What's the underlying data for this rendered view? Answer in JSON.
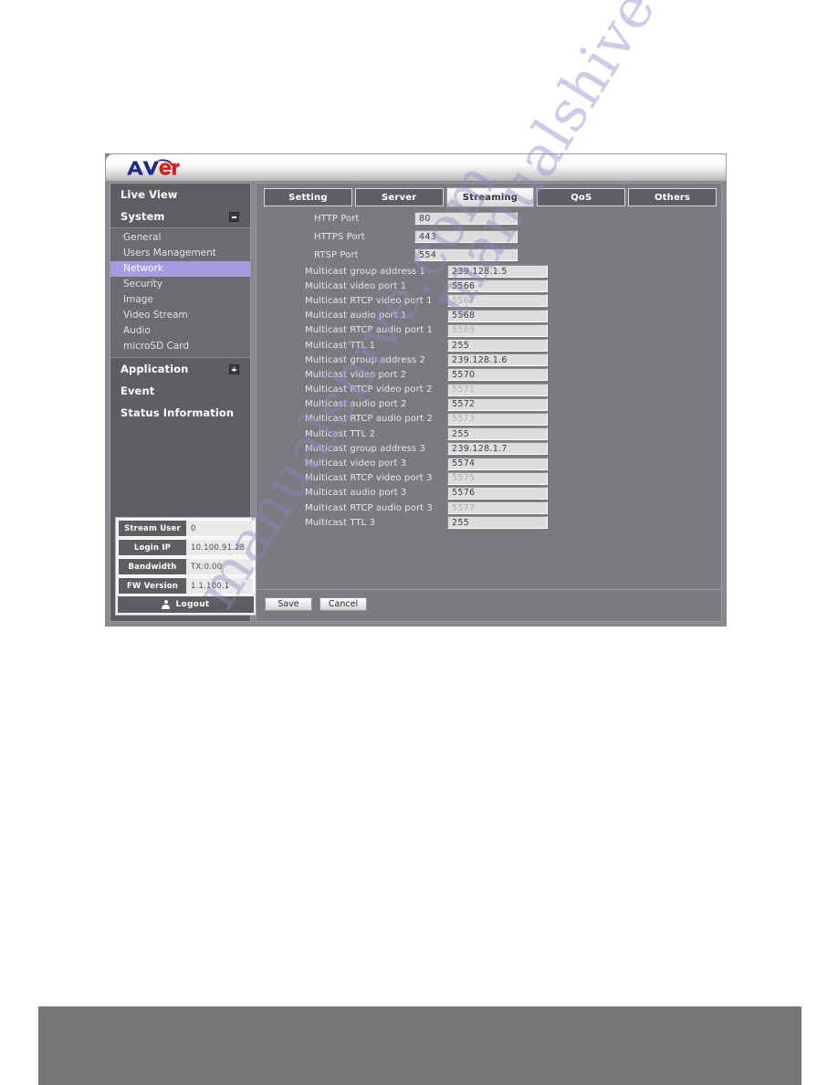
{
  "brand": {
    "logo_text_primary": "AV",
    "logo_text_accent": "er"
  },
  "sidebar": {
    "nav": [
      {
        "label": "Live View",
        "toggle": "none"
      },
      {
        "label": "System",
        "toggle": "minus"
      }
    ],
    "system_children": [
      {
        "label": "General",
        "selected": false
      },
      {
        "label": "Users Management",
        "selected": false
      },
      {
        "label": "Network",
        "selected": true
      },
      {
        "label": "Security",
        "selected": false
      },
      {
        "label": "Image",
        "selected": false
      },
      {
        "label": "Video Stream",
        "selected": false
      },
      {
        "label": "Audio",
        "selected": false
      },
      {
        "label": "microSD Card",
        "selected": false
      }
    ],
    "nav_rest": [
      {
        "label": "Application",
        "toggle": "plus"
      },
      {
        "label": "Event",
        "toggle": "none"
      },
      {
        "label": "Status Information",
        "toggle": "none"
      }
    ],
    "status": [
      {
        "key": "Stream User",
        "value": "0"
      },
      {
        "key": "Login IP",
        "value": "10.100.91.28"
      },
      {
        "key": "Bandwidth",
        "value": "TX:0.00"
      },
      {
        "key": "FW Version",
        "value": "1.1.100.1"
      }
    ],
    "logout_label": "Logout"
  },
  "tabs": [
    {
      "label": "Setting",
      "active": false
    },
    {
      "label": "Server",
      "active": false
    },
    {
      "label": "Streaming",
      "active": true
    },
    {
      "label": "QoS",
      "active": false
    },
    {
      "label": "Others",
      "active": false
    }
  ],
  "form": {
    "ports": [
      {
        "label": "HTTP Port",
        "value": "80",
        "disabled": false
      },
      {
        "label": "HTTPS Port",
        "value": "443",
        "disabled": false
      },
      {
        "label": "RTSP Port",
        "value": "554",
        "disabled": false
      }
    ],
    "multicast": [
      {
        "label": "Multicast group address 1",
        "value": "239.128.1.5",
        "disabled": false
      },
      {
        "label": "Multicast video port 1",
        "value": "5566",
        "disabled": false
      },
      {
        "label": "Multicast RTCP video port 1",
        "value": "5567",
        "disabled": true
      },
      {
        "label": "Multicast audio port 1",
        "value": "5568",
        "disabled": false
      },
      {
        "label": "Multicast RTCP audio port 1",
        "value": "5569",
        "disabled": true
      },
      {
        "label": "Multicast TTL 1",
        "value": "255",
        "disabled": false
      },
      {
        "label": "Multicast group address 2",
        "value": "239.128.1.6",
        "disabled": false
      },
      {
        "label": "Multicast video port 2",
        "value": "5570",
        "disabled": false
      },
      {
        "label": "Multicast RTCP video port 2",
        "value": "5571",
        "disabled": true
      },
      {
        "label": "Multicast audio port 2",
        "value": "5572",
        "disabled": false
      },
      {
        "label": "Multicast RTCP audio port 2",
        "value": "5573",
        "disabled": true
      },
      {
        "label": "Multicast TTL 2",
        "value": "255",
        "disabled": false
      },
      {
        "label": "Multicast group address 3",
        "value": "239.128.1.7",
        "disabled": false
      },
      {
        "label": "Multicast video port 3",
        "value": "5574",
        "disabled": false
      },
      {
        "label": "Multicast RTCP video port 3",
        "value": "5575",
        "disabled": true
      },
      {
        "label": "Multicast audio port 3",
        "value": "5576",
        "disabled": false
      },
      {
        "label": "Multicast RTCP audio port 3",
        "value": "5577",
        "disabled": true
      },
      {
        "label": "Multicast TTL 3",
        "value": "255",
        "disabled": false
      }
    ]
  },
  "buttons": {
    "save": "Save",
    "cancel": "Cancel"
  },
  "watermark": {
    "line1": "manualshive.com",
    "line2": "manualshive.com"
  },
  "colors": {
    "sidebar_bg": "#5e5e62",
    "content_bg": "#7b7b7f",
    "selected_nav": "#a89ae0",
    "input_bg": "#dddddd",
    "logo_blue": "#1d2a8c",
    "logo_red": "#d81f26",
    "footer_band": "#767676"
  }
}
